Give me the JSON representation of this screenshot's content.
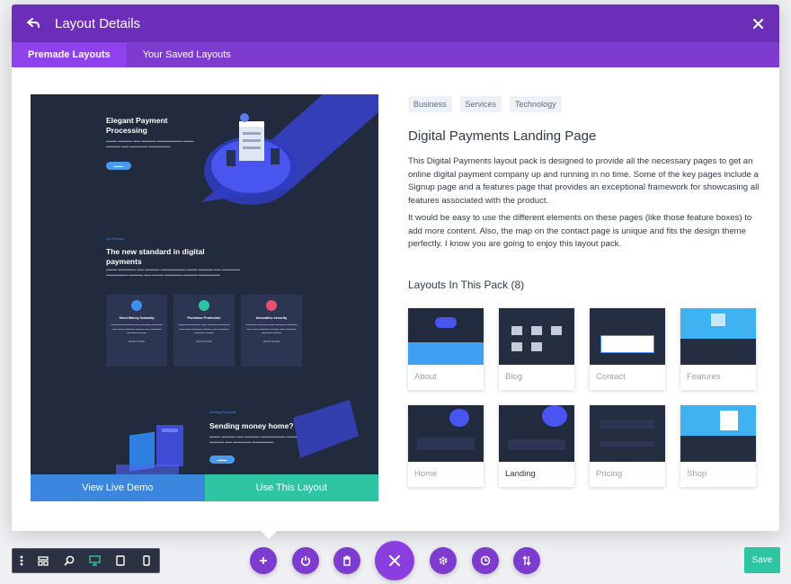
{
  "header": {
    "title": "Layout Details"
  },
  "tabs": [
    {
      "label": "Premade Layouts",
      "active": true
    },
    {
      "label": "Your Saved Layouts",
      "active": false
    }
  ],
  "preview": {
    "hero_title_line1": "Elegant Payment",
    "hero_title_line2": "Processing",
    "section_tag": "Our Services",
    "section_title_line1": "The new standard in digital",
    "section_title_line2": "payments",
    "cards": [
      {
        "title": "Send Money Instantly",
        "link": "READ MORE"
      },
      {
        "title": "Purchase Protection",
        "link": "READ MORE"
      },
      {
        "title": "Innovative security",
        "link": "READ MORE"
      }
    ],
    "bottom_tag": "Sending Payments",
    "bottom_title": "Sending money home?",
    "view_demo_label": "View Live Demo",
    "use_layout_label": "Use This Layout"
  },
  "details": {
    "tags": [
      "Business",
      "Services",
      "Technology"
    ],
    "title": "Digital Payments Landing Page",
    "paragraph1": "This Digital Payments layout pack is designed to provide all the necessary pages to get an online digital payment company up and running in no time. Some of the key pages include a Signup page and a features page that provides an exceptional framework for showcasing all features associated with the product.",
    "paragraph2": "It would be easy to use the different elements on these pages (like those feature boxes) to add more content. Also, the map on the contact page is unique and fits the design theme perfectly. I know you are going to enjoy this layout pack.",
    "layouts_heading": "Layouts In This Pack (8)",
    "layouts": [
      {
        "label": "About",
        "selected": false
      },
      {
        "label": "Blog",
        "selected": false
      },
      {
        "label": "Contact",
        "selected": false
      },
      {
        "label": "Features",
        "selected": false
      },
      {
        "label": "Home",
        "selected": false
      },
      {
        "label": "Landing",
        "selected": true
      },
      {
        "label": "Pricing",
        "selected": false
      },
      {
        "label": "Shop",
        "selected": false
      }
    ]
  },
  "bottom_bar": {
    "save_label": "Save",
    "left_icons": [
      "dots-menu-icon",
      "wireframe-icon",
      "zoom-icon",
      "desktop-icon",
      "tablet-icon",
      "phone-icon"
    ],
    "center_icons": [
      "add-icon",
      "power-icon",
      "trash-icon",
      "close-icon",
      "settings-icon",
      "history-icon",
      "sort-icon"
    ]
  },
  "colors": {
    "header": "#6c2eb9",
    "tabs": "#7e3bd0",
    "demo_button": "#3b87de",
    "use_button": "#2ec5a2",
    "save": "#2ec5a2"
  }
}
